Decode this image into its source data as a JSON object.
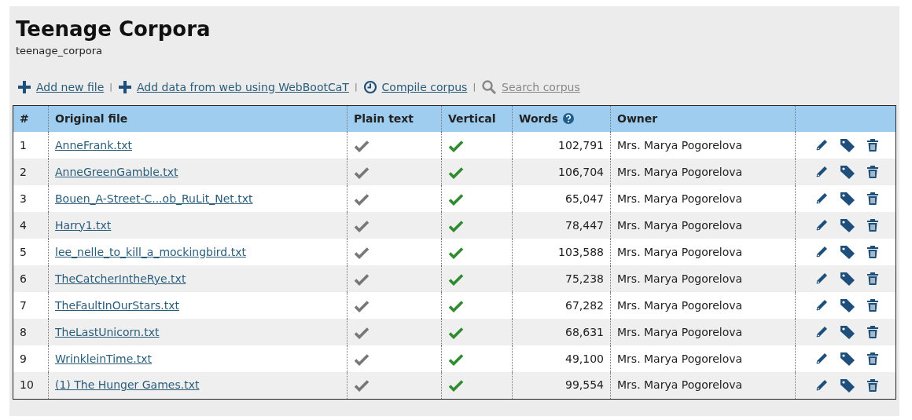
{
  "title": "Teenage Corpora",
  "subtitle": "teenage_corpora",
  "actions": [
    {
      "kind": "add",
      "label": "Add new file",
      "disabled": false
    },
    {
      "kind": "add",
      "separator": "|",
      "label": "Add data from web using WebBootCaT",
      "disabled": false
    },
    {
      "kind": "clock",
      "separator": "|",
      "label": "Compile corpus",
      "disabled": false
    },
    {
      "kind": "search",
      "separator": "|",
      "label": "Search corpus",
      "disabled": true
    }
  ],
  "table": {
    "columns": [
      "#",
      "Original file",
      "Plain text",
      "Vertical",
      "Words",
      "Owner"
    ],
    "rows": [
      {
        "index": "1",
        "file": "AnneFrank.txt",
        "plain_text": true,
        "vertical": true,
        "words": "102,791",
        "owner": "Mrs. Marya Pogorelova"
      },
      {
        "index": "2",
        "file": "AnneGreenGamble.txt",
        "plain_text": true,
        "vertical": true,
        "words": "106,704",
        "owner": "Mrs. Marya Pogorelova"
      },
      {
        "index": "3",
        "file": "Bouen_A-Street-C...ob_RuLit_Net.txt",
        "plain_text": true,
        "vertical": true,
        "words": "65,047",
        "owner": "Mrs. Marya Pogorelova"
      },
      {
        "index": "4",
        "file": "Harry1.txt",
        "plain_text": true,
        "vertical": true,
        "words": "78,447",
        "owner": "Mrs. Marya Pogorelova"
      },
      {
        "index": "5",
        "file": "lee_nelle_to_kill_a_mockingbird.txt",
        "plain_text": true,
        "vertical": true,
        "words": "103,588",
        "owner": "Mrs. Marya Pogorelova"
      },
      {
        "index": "6",
        "file": "TheCatcherIntheRye.txt",
        "plain_text": true,
        "vertical": true,
        "words": "75,238",
        "owner": "Mrs. Marya Pogorelova"
      },
      {
        "index": "7",
        "file": "TheFaultInOurStars.txt",
        "plain_text": true,
        "vertical": true,
        "words": "67,282",
        "owner": "Mrs. Marya Pogorelova"
      },
      {
        "index": "8",
        "file": "TheLastUnicorn.txt",
        "plain_text": true,
        "vertical": true,
        "words": "68,631",
        "owner": "Mrs. Marya Pogorelova"
      },
      {
        "index": "9",
        "file": "WrinkleinTime.txt",
        "plain_text": true,
        "vertical": true,
        "words": "49,100",
        "owner": "Mrs. Marya Pogorelova"
      },
      {
        "index": "10",
        "file": "(1) The Hunger Games.txt",
        "plain_text": true,
        "vertical": true,
        "words": "99,554",
        "owner": "Mrs. Marya Pogorelova"
      }
    ]
  }
}
